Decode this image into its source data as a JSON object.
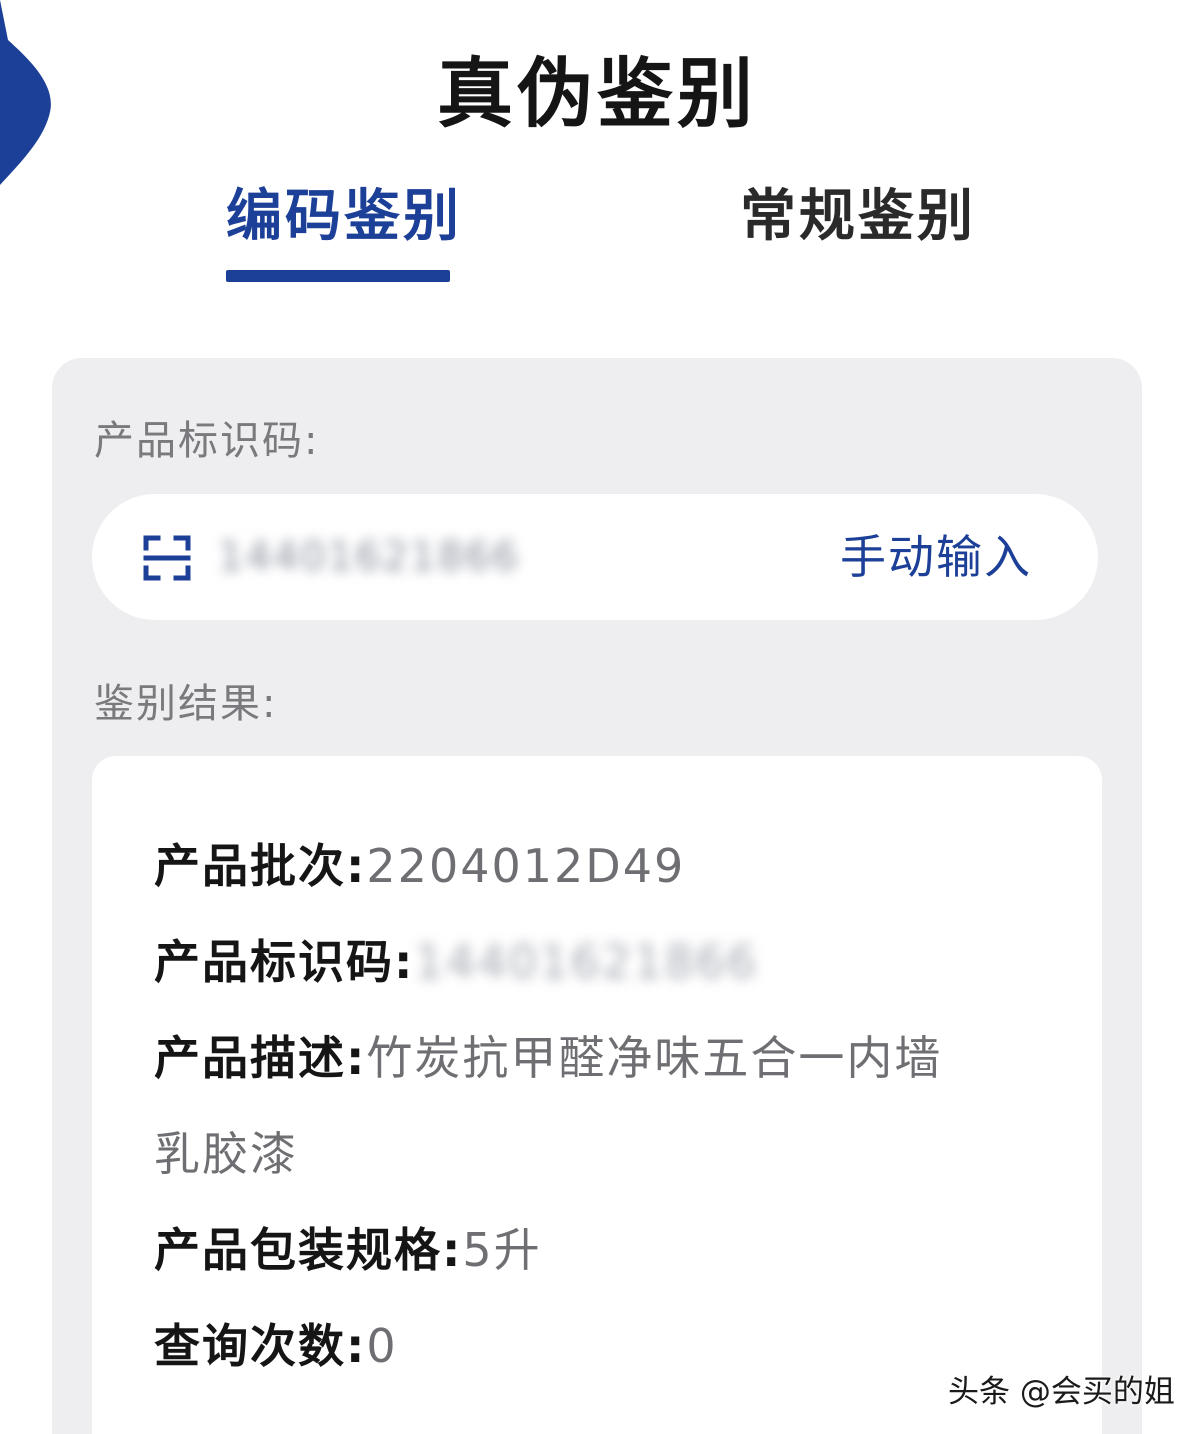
{
  "header": {
    "title": "真伪鉴别"
  },
  "tabs": [
    {
      "label": "编码鉴别",
      "active": true
    },
    {
      "label": "常规鉴别",
      "active": false
    }
  ],
  "form": {
    "code_label": "产品标识码:",
    "code_value": "14401621866",
    "manual_input": "手动输入",
    "result_label": "鉴别结果:"
  },
  "result": {
    "batch_key": "产品批次:",
    "batch_value": "2204012D49",
    "id_key": "产品标识码:",
    "id_value": "14401621866",
    "desc_key": "产品描述:",
    "desc_value_line1": "竹炭抗甲醛净味五合一内墙",
    "desc_value_line2": "乳胶漆",
    "spec_key": "产品包装规格:",
    "spec_value": "5升",
    "count_key": "查询次数:",
    "count_value": "0"
  },
  "watermark": "头条 @会买的姐",
  "colors": {
    "accent": "#1c3f97",
    "card_bg": "#eeeef0",
    "text_dark": "#151515",
    "text_muted": "#6f6f73"
  },
  "icons": {
    "scan": "scan-icon",
    "back": "back-arrow-icon"
  }
}
